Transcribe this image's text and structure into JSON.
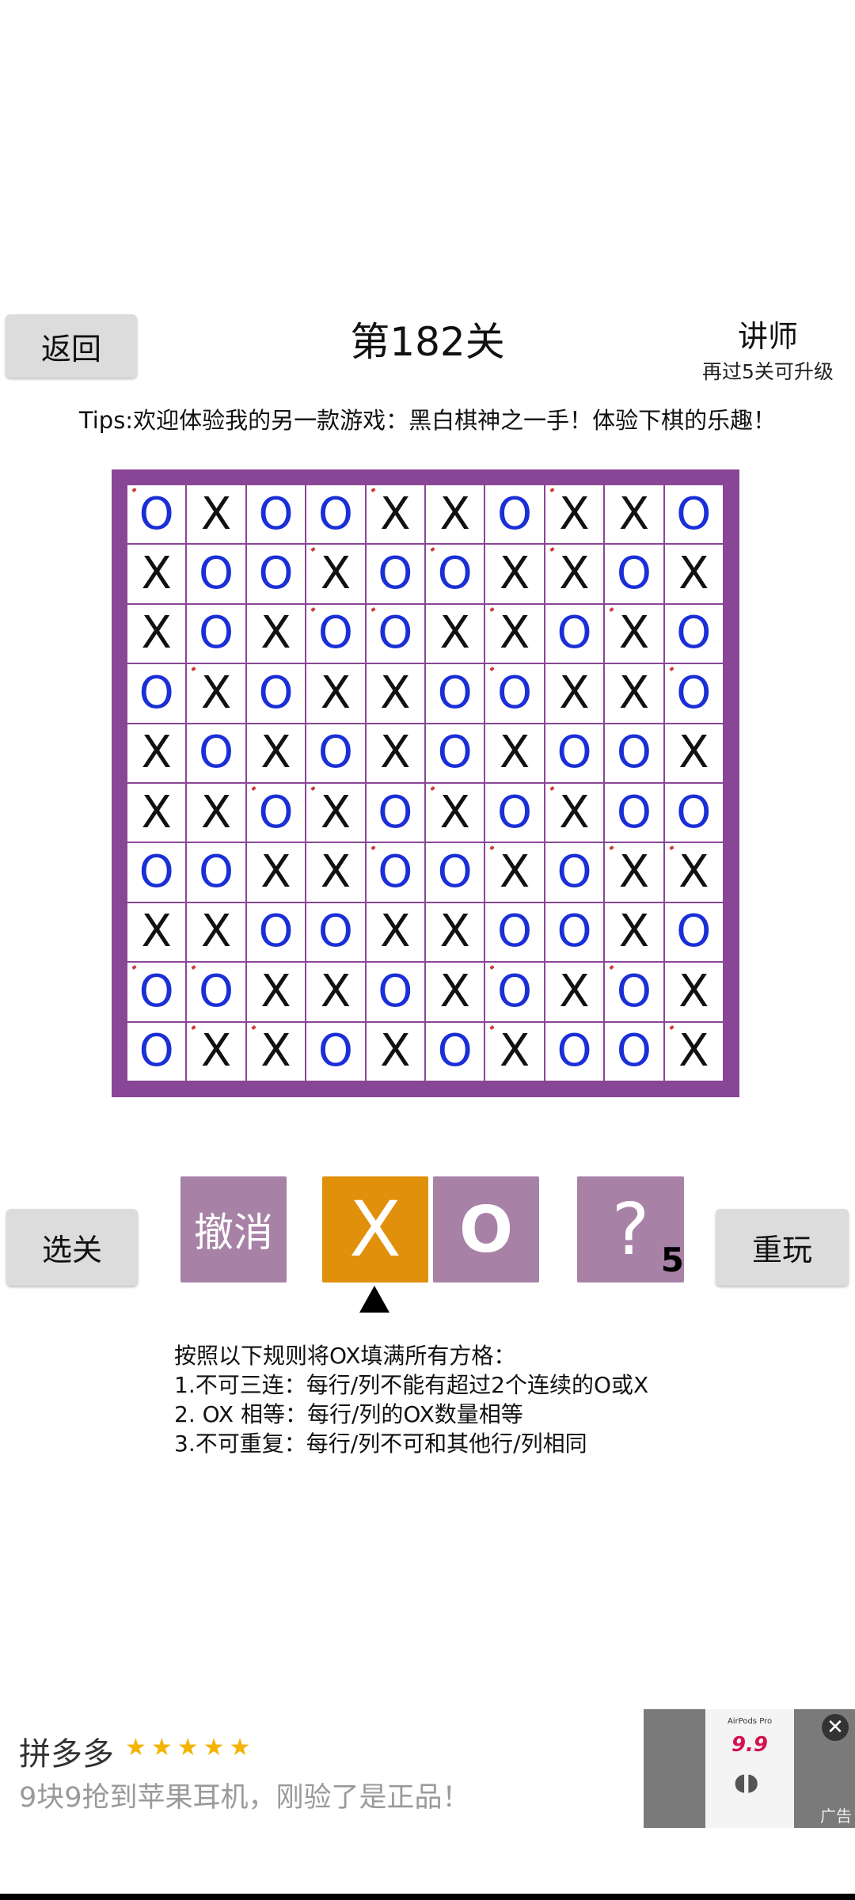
{
  "header": {
    "back_label": "返回",
    "level_title": "第182关",
    "rank": "讲师",
    "rank_sub": "再过5关可升级",
    "tips": "Tips:欢迎体验我的另一款游戏：黑白棋神之一手！体验下棋的乐趣！"
  },
  "board": {
    "rows": [
      [
        "O",
        "X",
        "O",
        "O",
        "X",
        "X",
        "O",
        "X",
        "X",
        "O"
      ],
      [
        "X",
        "O",
        "O",
        "X",
        "O",
        "O",
        "X",
        "X",
        "O",
        "X"
      ],
      [
        "X",
        "O",
        "X",
        "O",
        "O",
        "X",
        "X",
        "O",
        "X",
        "O"
      ],
      [
        "O",
        "X",
        "O",
        "X",
        "X",
        "O",
        "O",
        "X",
        "X",
        "O"
      ],
      [
        "X",
        "O",
        "X",
        "O",
        "X",
        "O",
        "X",
        "O",
        "O",
        "X"
      ],
      [
        "X",
        "X",
        "O",
        "X",
        "O",
        "X",
        "O",
        "X",
        "O",
        "O"
      ],
      [
        "O",
        "O",
        "X",
        "X",
        "O",
        "O",
        "X",
        "O",
        "X",
        "X"
      ],
      [
        "X",
        "X",
        "O",
        "O",
        "X",
        "X",
        "O",
        "O",
        "X",
        "O"
      ],
      [
        "O",
        "O",
        "X",
        "X",
        "O",
        "X",
        "O",
        "X",
        "O",
        "X"
      ],
      [
        "O",
        "X",
        "X",
        "O",
        "X",
        "O",
        "X",
        "O",
        "O",
        "X"
      ]
    ],
    "given_marks": [
      [
        1,
        0,
        0,
        0,
        1,
        0,
        0,
        1,
        0,
        0
      ],
      [
        0,
        0,
        0,
        1,
        0,
        1,
        0,
        1,
        0,
        0
      ],
      [
        0,
        0,
        0,
        1,
        1,
        0,
        1,
        0,
        1,
        0
      ],
      [
        0,
        1,
        0,
        0,
        0,
        0,
        1,
        0,
        0,
        1
      ],
      [
        0,
        0,
        0,
        0,
        0,
        0,
        0,
        0,
        0,
        0
      ],
      [
        0,
        0,
        1,
        1,
        0,
        1,
        0,
        1,
        0,
        0
      ],
      [
        0,
        0,
        0,
        0,
        1,
        0,
        1,
        0,
        1,
        1
      ],
      [
        0,
        0,
        0,
        0,
        0,
        0,
        0,
        0,
        0,
        0
      ],
      [
        1,
        1,
        0,
        0,
        0,
        0,
        1,
        0,
        1,
        0
      ],
      [
        0,
        1,
        1,
        0,
        0,
        0,
        1,
        0,
        0,
        1
      ]
    ],
    "colors": {
      "border": "#8a4696",
      "o": "#1a2fd6",
      "x": "#111111",
      "mark": "#d23a3a"
    }
  },
  "controls": {
    "select_label": "选关",
    "undo_label": "撤消",
    "x_label": "X",
    "o_label": "O",
    "hint_label": "?",
    "hint_count": "5",
    "replay_label": "重玩",
    "selected": "X"
  },
  "rules": [
    "按照以下规则将OX填满所有方格：",
    "1.不可三连：每行/列不能有超过2个连续的O或X",
    "2. OX 相等：每行/列的OX数量相等",
    "3.不可重复：每行/列不可和其他行/列相同"
  ],
  "ad": {
    "brand": "拼多多",
    "stars": "★★★★★",
    "text": "9块9抢到苹果耳机，刚验了是正品！",
    "card_title": "AirPods Pro",
    "card_price": "9.9",
    "label": "广告",
    "close": "✕"
  }
}
